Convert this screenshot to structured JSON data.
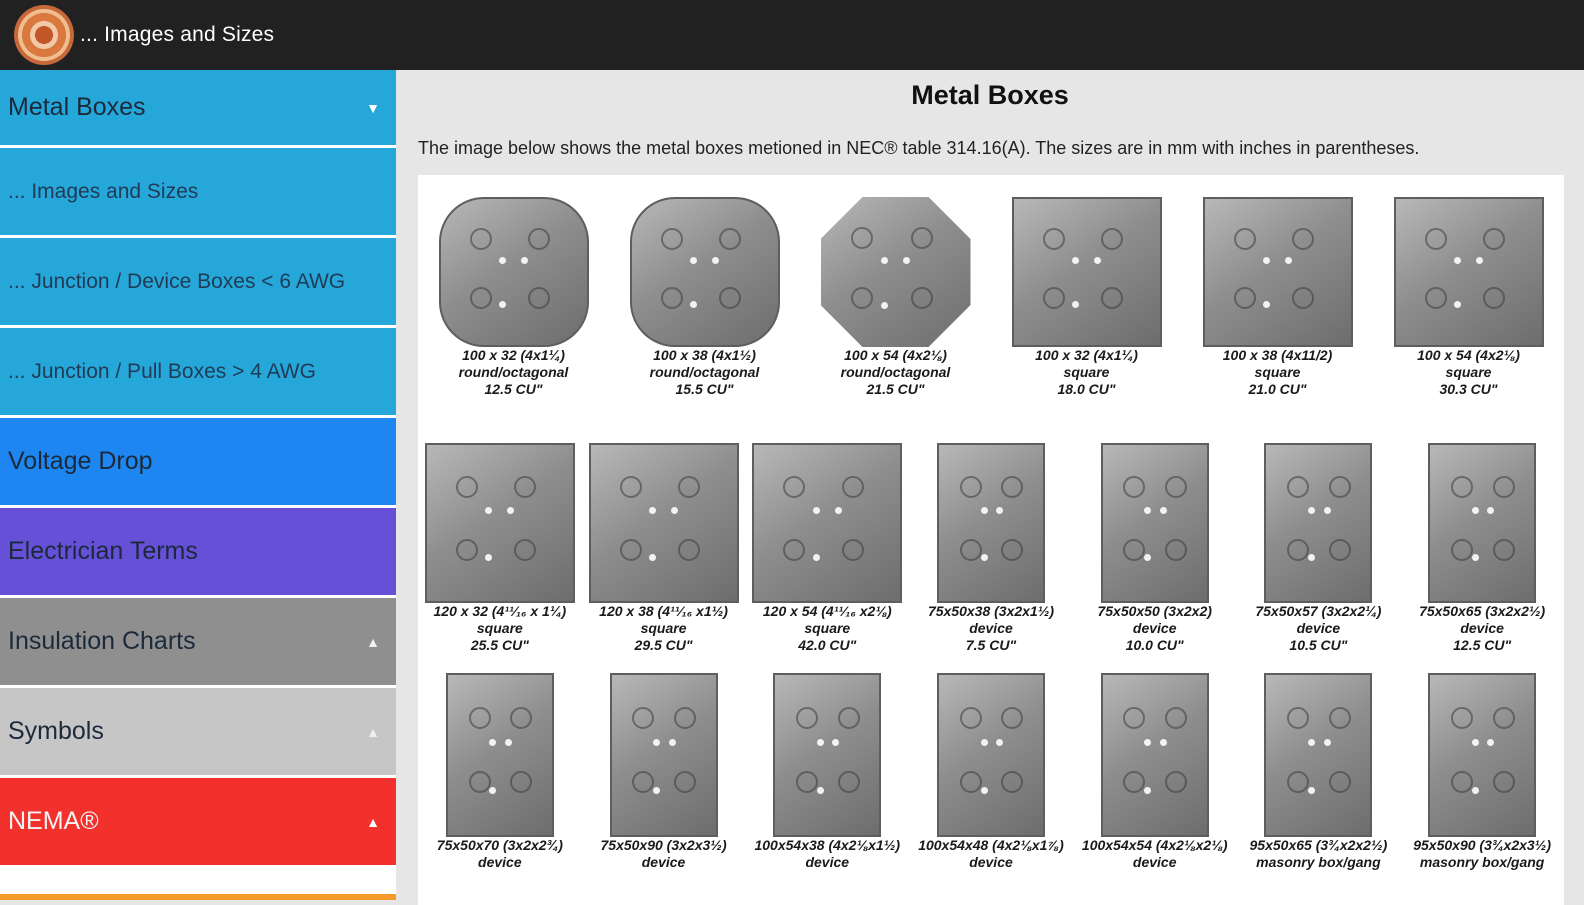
{
  "header": {
    "title": "... Images and Sizes",
    "logo_icon": "app-logo-icon"
  },
  "sidebar": {
    "items": [
      {
        "label": "Metal Boxes",
        "chevron": "▼"
      },
      {
        "label": "... Images and Sizes"
      },
      {
        "label": "... Junction / Device Boxes < 6 AWG"
      },
      {
        "label": "... Junction / Pull Boxes > 4 AWG"
      },
      {
        "label": "Voltage Drop"
      },
      {
        "label": "Electrician Terms"
      },
      {
        "label": "Insulation Charts",
        "chevron": "▲"
      },
      {
        "label": "Symbols",
        "chevron": "▲"
      },
      {
        "label": "NEMA®",
        "chevron": "▲"
      }
    ]
  },
  "main": {
    "title": "Metal Boxes",
    "description": "The image below shows the metal boxes metioned in NEC® table 314.16(A). The sizes are in mm with inches in parentheses.",
    "rows": [
      [
        {
          "size": "100 x 32 (4x1¼)",
          "type": "round/octagonal",
          "cu": "12.5 CU\""
        },
        {
          "size": "100 x 38 (4x1½)",
          "type": "round/octagonal",
          "cu": "15.5 CU\""
        },
        {
          "size": "100 x 54 (4x2⅛)",
          "type": "round/octagonal",
          "cu": "21.5 CU\""
        },
        {
          "size": "100 x 32 (4x1¼)",
          "type": "square",
          "cu": "18.0 CU\""
        },
        {
          "size": "100 x 38 (4x11/2)",
          "type": "square",
          "cu": "21.0 CU\""
        },
        {
          "size": "100 x 54 (4x2⅛)",
          "type": "square",
          "cu": "30.3 CU\""
        }
      ],
      [
        {
          "size": "120 x 32 (4¹¹⁄₁₆ x 1¼)",
          "type": "square",
          "cu": "25.5 CU\""
        },
        {
          "size": "120 x 38 (4¹¹⁄₁₆ x1½)",
          "type": "square",
          "cu": "29.5 CU\""
        },
        {
          "size": "120 x 54 (4¹¹⁄₁₆ x2⅛)",
          "type": "square",
          "cu": "42.0 CU\""
        },
        {
          "size": "75x50x38 (3x2x1½)",
          "type": "device",
          "cu": "7.5 CU\""
        },
        {
          "size": "75x50x50 (3x2x2)",
          "type": "device",
          "cu": "10.0 CU\""
        },
        {
          "size": "75x50x57 (3x2x2¼)",
          "type": "device",
          "cu": "10.5 CU\""
        },
        {
          "size": "75x50x65 (3x2x2½)",
          "type": "device",
          "cu": "12.5 CU\""
        }
      ],
      [
        {
          "size": "75x50x70 (3x2x2¾)",
          "type": "device",
          "cu": ""
        },
        {
          "size": "75x50x90 (3x2x3½)",
          "type": "device",
          "cu": ""
        },
        {
          "size": "100x54x38 (4x2⅛x1½)",
          "type": "device",
          "cu": ""
        },
        {
          "size": "100x54x48 (4x2⅛x1⅞)",
          "type": "device",
          "cu": ""
        },
        {
          "size": "100x54x54 (4x2⅛x2⅛)",
          "type": "device",
          "cu": ""
        },
        {
          "size": "95x50x65 (3¾x2x2½)",
          "type": "masonry box/gang",
          "cu": ""
        },
        {
          "size": "95x50x90 (3¾x2x3½)",
          "type": "masonry box/gang",
          "cu": ""
        }
      ]
    ]
  }
}
